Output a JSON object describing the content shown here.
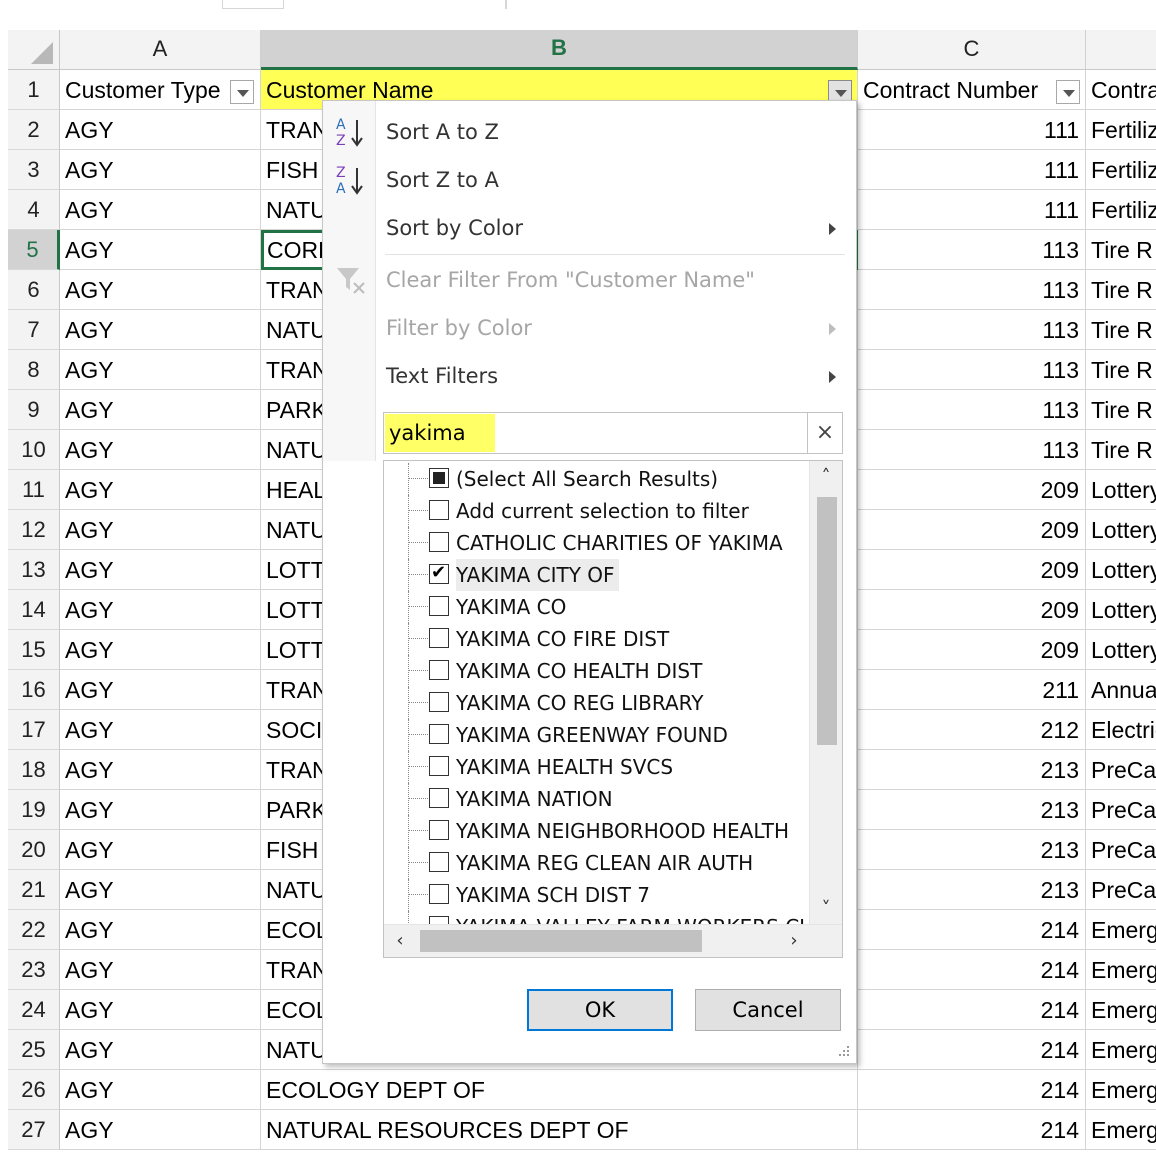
{
  "columns": {
    "a": "A",
    "b": "B",
    "c": "C"
  },
  "header_row": {
    "row_number": "1",
    "a": "Customer Type",
    "b": "Customer Name",
    "c": "Contract Number",
    "d": "Contract"
  },
  "rows": [
    {
      "n": "2",
      "type": "AGY",
      "name": "TRANSPORTATION DEPT OF",
      "num": "111",
      "contract": "Fertilizer"
    },
    {
      "n": "3",
      "type": "AGY",
      "name": "FISH & WILDLIFE DEPT OF",
      "num": "111",
      "contract": "Fertilizer"
    },
    {
      "n": "4",
      "type": "AGY",
      "name": "NATURAL RESOURCES DEPT OF",
      "num": "111",
      "contract": "Fertilizer"
    },
    {
      "n": "5",
      "type": "AGY",
      "name": "CORRECTIONS DEPT OF",
      "num": "113",
      "contract": "Tire R"
    },
    {
      "n": "6",
      "type": "AGY",
      "name": "TRANSPORTATION DEPT OF",
      "num": "113",
      "contract": "Tire R"
    },
    {
      "n": "7",
      "type": "AGY",
      "name": "NATURAL RESOURCES DEPT OF",
      "num": "113",
      "contract": "Tire R"
    },
    {
      "n": "8",
      "type": "AGY",
      "name": "TRANSPORTATION DEPT OF",
      "num": "113",
      "contract": "Tire R"
    },
    {
      "n": "9",
      "type": "AGY",
      "name": "PARKS & RECREATION COMM",
      "num": "113",
      "contract": "Tire R"
    },
    {
      "n": "10",
      "type": "AGY",
      "name": "NATURAL RESOURCES DEPT OF",
      "num": "113",
      "contract": "Tire R"
    },
    {
      "n": "11",
      "type": "AGY",
      "name": "HEALTH DEPT OF",
      "num": "209",
      "contract": "Lottery"
    },
    {
      "n": "12",
      "type": "AGY",
      "name": "NATURAL RESOURCES DEPT OF",
      "num": "209",
      "contract": "Lottery"
    },
    {
      "n": "13",
      "type": "AGY",
      "name": "LOTTERY COMMISSION",
      "num": "209",
      "contract": "Lottery"
    },
    {
      "n": "14",
      "type": "AGY",
      "name": "LOTTERY COMMISSION",
      "num": "209",
      "contract": "Lottery"
    },
    {
      "n": "15",
      "type": "AGY",
      "name": "LOTTERY COMMISSION",
      "num": "209",
      "contract": "Lottery"
    },
    {
      "n": "16",
      "type": "AGY",
      "name": "TRANSPORTATION DEPT OF",
      "num": "211",
      "contract": "Annual"
    },
    {
      "n": "17",
      "type": "AGY",
      "name": "SOCIAL & HEALTH SVCS",
      "num": "212",
      "contract": "Electric"
    },
    {
      "n": "18",
      "type": "AGY",
      "name": "TRANSPORTATION DEPT OF",
      "num": "213",
      "contract": "PreCast"
    },
    {
      "n": "19",
      "type": "AGY",
      "name": "PARKS & RECREATION COMM",
      "num": "213",
      "contract": "PreCast"
    },
    {
      "n": "20",
      "type": "AGY",
      "name": "FISH & WILDLIFE DEPT OF",
      "num": "213",
      "contract": "PreCast"
    },
    {
      "n": "21",
      "type": "AGY",
      "name": "NATURAL RESOURCES DEPT OF",
      "num": "213",
      "contract": "PreCast"
    },
    {
      "n": "22",
      "type": "AGY",
      "name": "ECOLOGY DEPT OF",
      "num": "214",
      "contract": "Emergency"
    },
    {
      "n": "23",
      "type": "AGY",
      "name": "TRANSPORTATION DEPT OF",
      "num": "214",
      "contract": "Emergency"
    },
    {
      "n": "24",
      "type": "AGY",
      "name": "ECOLOGY DEPT OF",
      "num": "214",
      "contract": "Emergency"
    },
    {
      "n": "25",
      "type": "AGY",
      "name": "NATURAL RESOURCES DEPT OF",
      "num": "214",
      "contract": "Emergency"
    },
    {
      "n": "26",
      "type": "AGY",
      "name": "ECOLOGY DEPT OF",
      "num": "214",
      "contract": "Emergency"
    },
    {
      "n": "27",
      "type": "AGY",
      "name": "NATURAL RESOURCES DEPT OF",
      "num": "214",
      "contract": "Emergency"
    }
  ],
  "filter_menu": {
    "sort_az": "Sort A to Z",
    "sort_za": "Sort Z to A",
    "sort_by_color": "Sort by Color",
    "clear_filter": "Clear Filter From \"Customer Name\"",
    "filter_by_color": "Filter by Color",
    "text_filters": "Text Filters",
    "search_value": "yakima",
    "clear_search": "×",
    "items": [
      {
        "label": "(Select All Search Results)",
        "state": "mixed"
      },
      {
        "label": "Add current selection to filter",
        "state": "unchecked"
      },
      {
        "label": "CATHOLIC CHARITIES OF YAKIMA",
        "state": "unchecked"
      },
      {
        "label": "YAKIMA CITY OF",
        "state": "checked"
      },
      {
        "label": "YAKIMA CO",
        "state": "unchecked"
      },
      {
        "label": "YAKIMA CO FIRE DIST",
        "state": "unchecked"
      },
      {
        "label": "YAKIMA CO HEALTH DIST",
        "state": "unchecked"
      },
      {
        "label": "YAKIMA CO REG LIBRARY",
        "state": "unchecked"
      },
      {
        "label": "YAKIMA GREENWAY FOUND",
        "state": "unchecked"
      },
      {
        "label": "YAKIMA HEALTH SVCS",
        "state": "unchecked"
      },
      {
        "label": "YAKIMA NATION",
        "state": "unchecked"
      },
      {
        "label": "YAKIMA NEIGHBORHOOD HEALTH",
        "state": "unchecked"
      },
      {
        "label": "YAKIMA REG CLEAN AIR AUTH",
        "state": "unchecked"
      },
      {
        "label": "YAKIMA SCH DIST 7",
        "state": "unchecked"
      },
      {
        "label": "YAKIMA VALLEY FARM WORKERS CLINIC",
        "state": "unchecked"
      }
    ],
    "ok": "OK",
    "cancel": "Cancel"
  },
  "colors": {
    "highlight": "#ffff55",
    "excel_green": "#217346",
    "ok_border": "#0078d7"
  }
}
